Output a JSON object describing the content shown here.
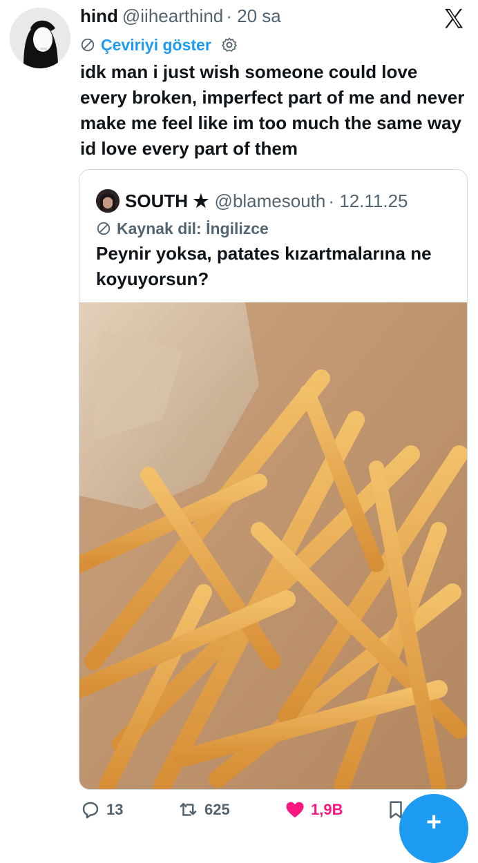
{
  "tweet": {
    "name": "hind",
    "handle": "@iihearthind",
    "time": "· 20 sa",
    "translate_label": "Çeviriyi göster",
    "text": "idk man i just wish someone could love every broken, imperfect part of me and never make me feel like im too much the same way id love every part of them"
  },
  "quote": {
    "name": "SOUTH ★",
    "handle": "@blamesouth",
    "date": "· 12.11.25",
    "source_label": "Kaynak dil: İngilizce",
    "text": "Peynir yoksa, patates kızartmalarına ne koyuyorsun?"
  },
  "actions": {
    "replies": "13",
    "retweets": "625",
    "likes": "1,9B"
  },
  "colors": {
    "accent": "#1d9bf0",
    "like": "#f91880",
    "retweet": "#536471",
    "muted": "#536471"
  },
  "icons": {
    "translate": "globe-slash-icon",
    "settings": "gear-icon",
    "brand": "x-logo-icon",
    "reply": "reply-icon",
    "retweet": "retweet-icon",
    "like": "heart-icon",
    "bookmark": "bookmark-icon",
    "compose": "plus-icon"
  }
}
